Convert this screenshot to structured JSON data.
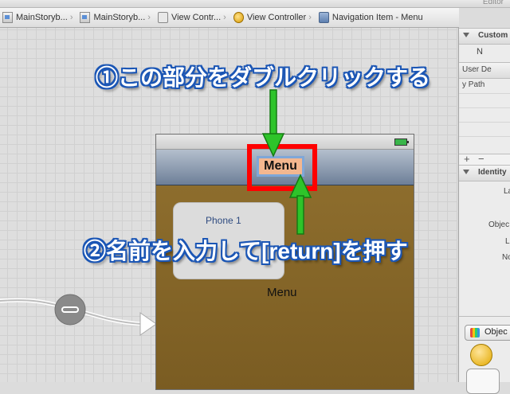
{
  "toolbar": {
    "right_label": "Editor"
  },
  "breadcrumb": [
    {
      "label": "MainStoryb...",
      "icon": "storyboard-icon"
    },
    {
      "label": "MainStoryb...",
      "icon": "storyboard-icon"
    },
    {
      "label": "View Contr...",
      "icon": "view-controller-icon"
    },
    {
      "label": "View Controller",
      "icon": "view-controller-gold-icon"
    },
    {
      "label": "Navigation Item - Menu",
      "icon": "navigation-item-icon"
    }
  ],
  "scene": {
    "navigation_title": "Menu",
    "button_text": "Phone 1",
    "content_label": "Menu"
  },
  "inspector": {
    "custom_section": "Custom",
    "user_defined": "User De",
    "key_path": "y Path",
    "identity_section": "Identity",
    "field_1": "La",
    "field_2": "Objec",
    "field_3": "L",
    "field_4": "No",
    "object_library_tab": "Objec"
  },
  "annotations": {
    "step1": "①この部分をダブルクリックする",
    "step2": "②名前を入力して[return]を押す"
  },
  "colors": {
    "highlight_frame": "#ff0000",
    "arrow": "#33dd22",
    "annotation_outline": "#1b56b5",
    "nav_title_bg": "#f4b78f"
  }
}
